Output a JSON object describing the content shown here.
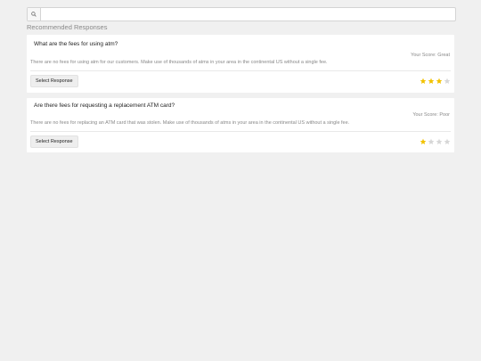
{
  "search": {
    "placeholder": "",
    "value": "",
    "icon": "search-icon"
  },
  "section_title": "Recommended Responses",
  "colors": {
    "star_filled": "#f2c200",
    "star_empty": "#d6d6d6"
  },
  "responses": [
    {
      "question": "What are the fees for using atm?",
      "score_label": "Your Score: Great",
      "answer": "There are no fees for using atm for our customers. Make use of thousands of atms in your area in the continental US without a single fee.",
      "button_label": "Select Response",
      "rating": 3,
      "max_rating": 4
    },
    {
      "question": "Are there fees for requesting a replacement ATM card?",
      "score_label": "Your Score: Poor",
      "answer": "There are no fees for replacing an ATM card that was stolen. Make use of thousands of atms in your area in the continental US without a single fee.",
      "button_label": "Select Response",
      "rating": 1,
      "max_rating": 4
    }
  ]
}
